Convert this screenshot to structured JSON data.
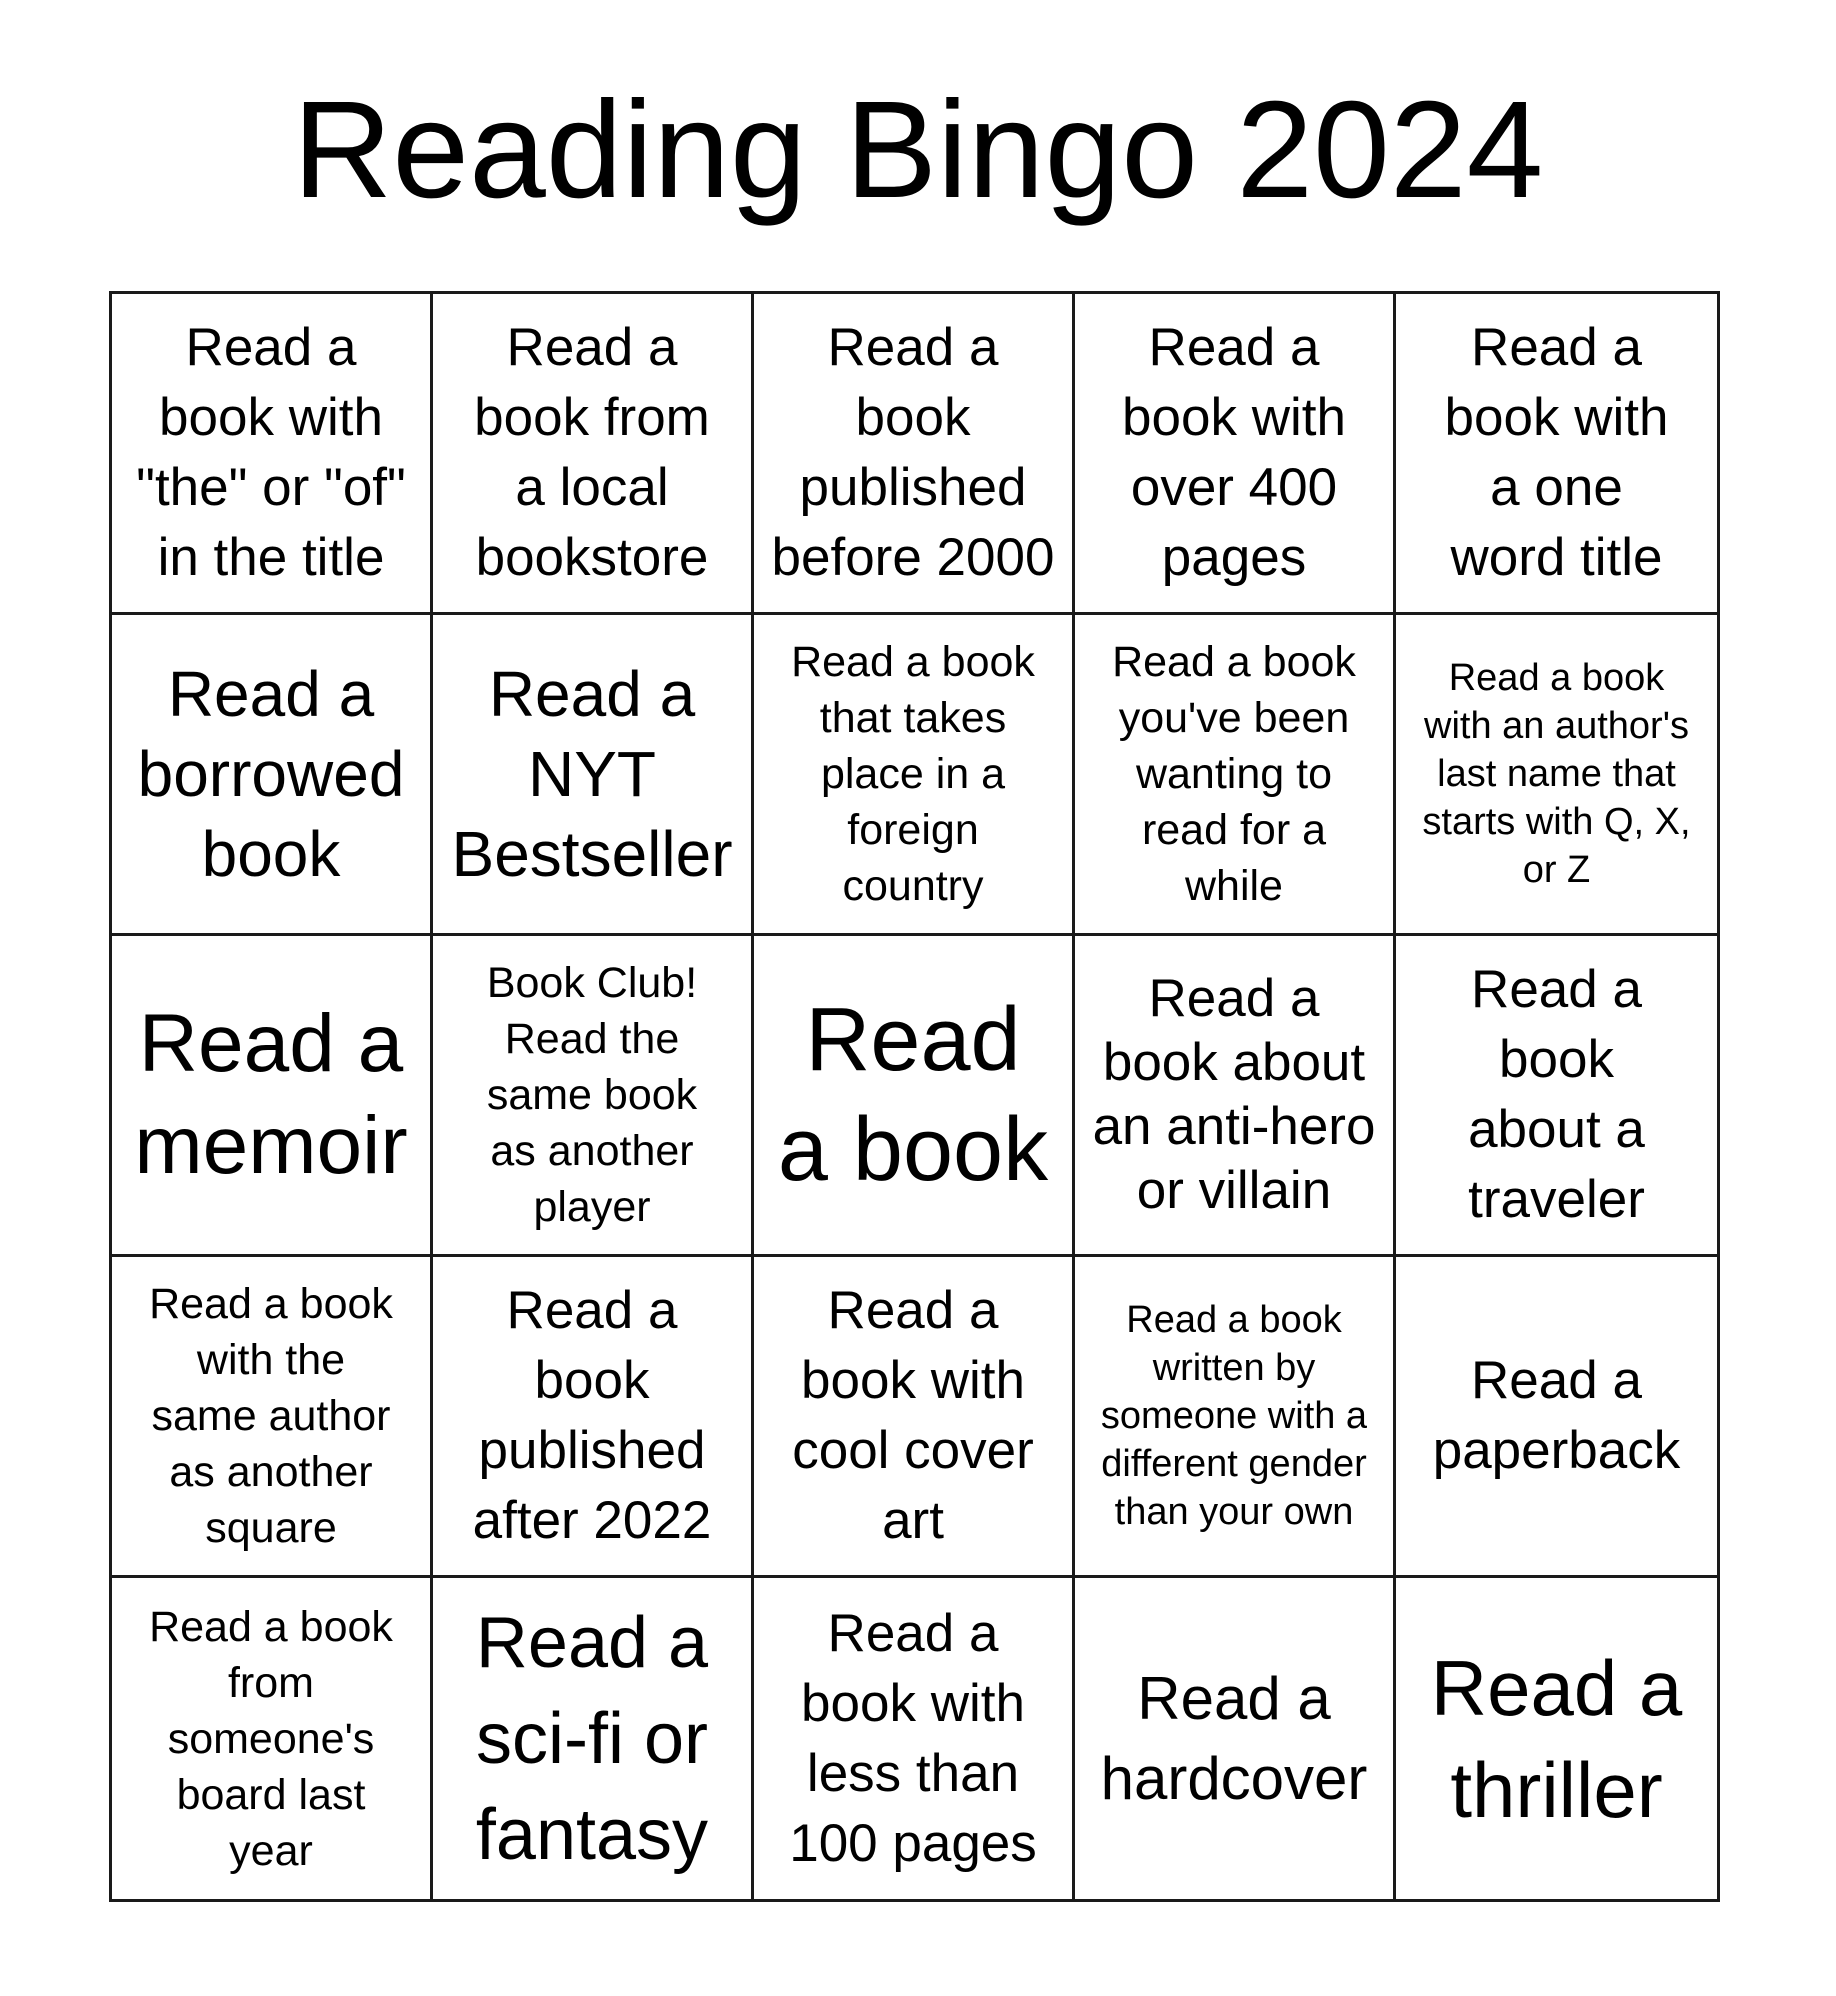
{
  "title": "Reading Bingo 2024",
  "board": {
    "rows": [
      [
        "Read a\nbook with\n\"the\" or \"of\"\nin the title",
        "Read a\nbook from\na local\nbookstore",
        "Read a\nbook\npublished\nbefore 2000",
        "Read a\nbook with\nover 400\npages",
        "Read a\nbook with\na one\nword title"
      ],
      [
        "Read a\nborrowed\nbook",
        "Read a\nNYT\nBestseller",
        "Read a book\nthat takes\nplace in a\nforeign\ncountry",
        "Read a book\nyou've been\nwanting to\nread for a\nwhile",
        "Read a book\nwith an author's\nlast name that\nstarts with Q, X,\nor Z"
      ],
      [
        "Read a\nmemoir",
        "Book Club!\nRead the\nsame book\nas another\nplayer",
        "Read\na book",
        "Read a\nbook about\nan anti-hero\nor villain",
        "Read a\nbook\nabout a\ntraveler"
      ],
      [
        "Read a book\nwith the\nsame author\nas another\nsquare",
        "Read a\nbook\npublished\nafter 2022",
        "Read a\nbook with\ncool cover\nart",
        "Read a book\nwritten by\nsomeone with a\ndifferent gender\nthan your own",
        "Read a\npaperback"
      ],
      [
        "Read a book\nfrom\nsomeone's\nboard last\nyear",
        "Read a\nsci-fi or\nfantasy",
        "Read a\nbook with\nless than\n100 pages",
        "Read a\nhardcover",
        "Read a\nthriller"
      ]
    ]
  }
}
